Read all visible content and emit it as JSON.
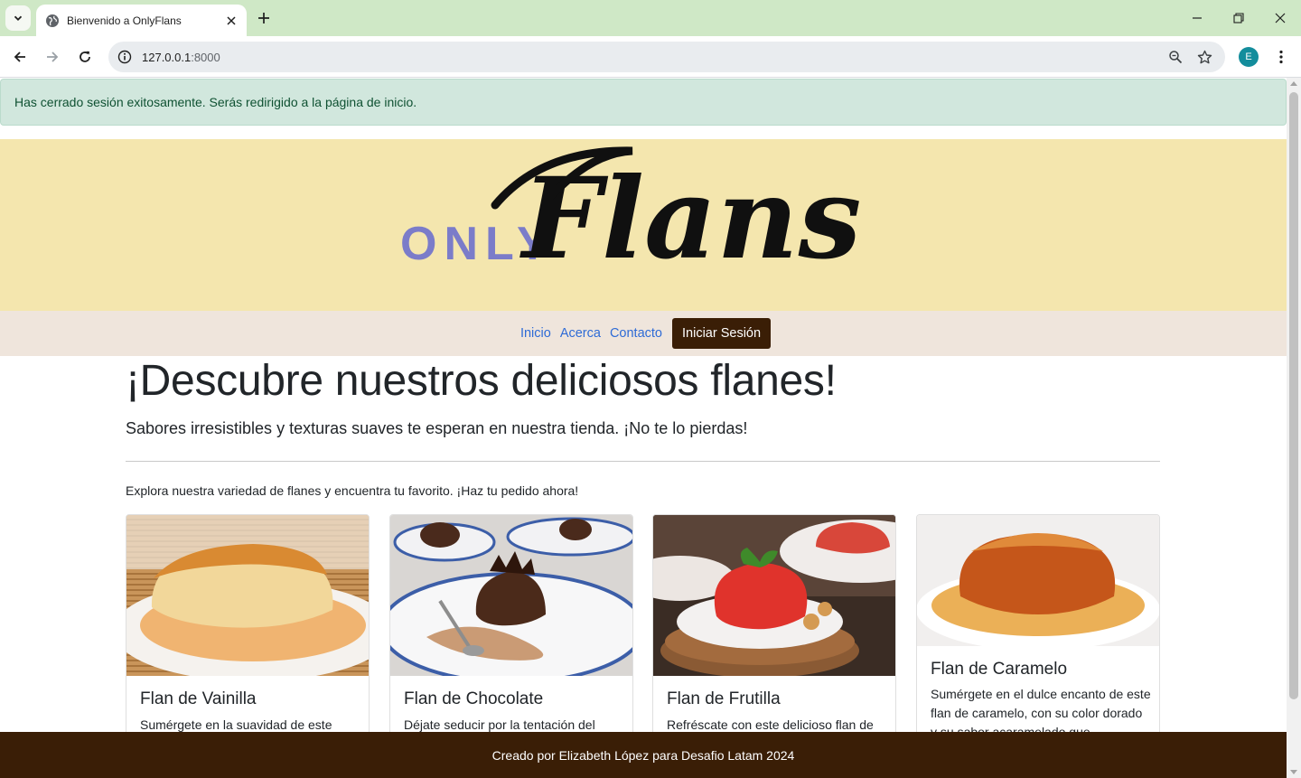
{
  "browser": {
    "tab_title": "Bienvenido a OnlyFlans",
    "url_host": "127.0.0.1",
    "url_port": ":8000",
    "profile_initial": "E"
  },
  "alert": {
    "message": "Has cerrado sesión exitosamente. Serás redirigido a la página de inicio."
  },
  "logo": {
    "word1": "ONLY",
    "word2": "Flans"
  },
  "nav": {
    "items": [
      "Inicio",
      "Acerca",
      "Contacto"
    ],
    "login": "Iniciar Sesión"
  },
  "hero": {
    "title": "¡Descubre nuestros deliciosos flanes!",
    "lead": "Sabores irresistibles y texturas suaves te esperan en nuestra tienda. ¡No te lo pierdas!",
    "intro": "Explora nuestra variedad de flanes y encuentra tu favorito. ¡Haz tu pedido ahora!"
  },
  "cards": [
    {
      "title": "Flan de Vainilla",
      "text": "Sumérgete en la suavidad de este"
    },
    {
      "title": "Flan de Chocolate",
      "text": "Déjate seducir por la tentación del"
    },
    {
      "title": "Flan de Frutilla",
      "text": "Refréscate con este delicioso flan de"
    },
    {
      "title": "Flan de Caramelo",
      "text": "Sumérgete en el dulce encanto de este flan de caramelo, con su color dorado y su sabor acaramelado que"
    }
  ],
  "footer": {
    "text": "Creado por Elizabeth López para Desafio Latam 2024"
  },
  "colors": {
    "tabstrip": "#cfe8c6",
    "alert_bg": "#d1e7dd",
    "header_band": "#f4e6ae",
    "navbar_bg": "#efe5dc",
    "brand_brown": "#3a1e06",
    "link_blue": "#2e6bd6",
    "logo_purple": "#7b7cc9"
  }
}
